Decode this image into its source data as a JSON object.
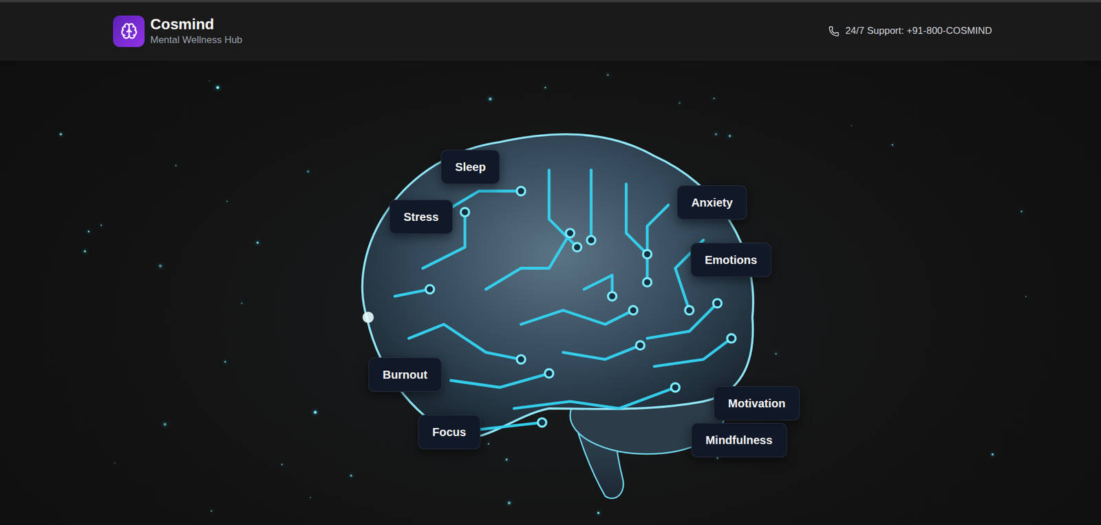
{
  "header": {
    "brand": "Cosmind",
    "tagline": "Mental Wellness Hub",
    "support": "24/7 Support: +91-800-COSMIND"
  },
  "topics": [
    {
      "label": "Sleep"
    },
    {
      "label": "Stress"
    },
    {
      "label": "Anxiety"
    },
    {
      "label": "Emotions"
    },
    {
      "label": "Burnout"
    },
    {
      "label": "Focus"
    },
    {
      "label": "Motivation"
    },
    {
      "label": "Mindfulness"
    }
  ]
}
